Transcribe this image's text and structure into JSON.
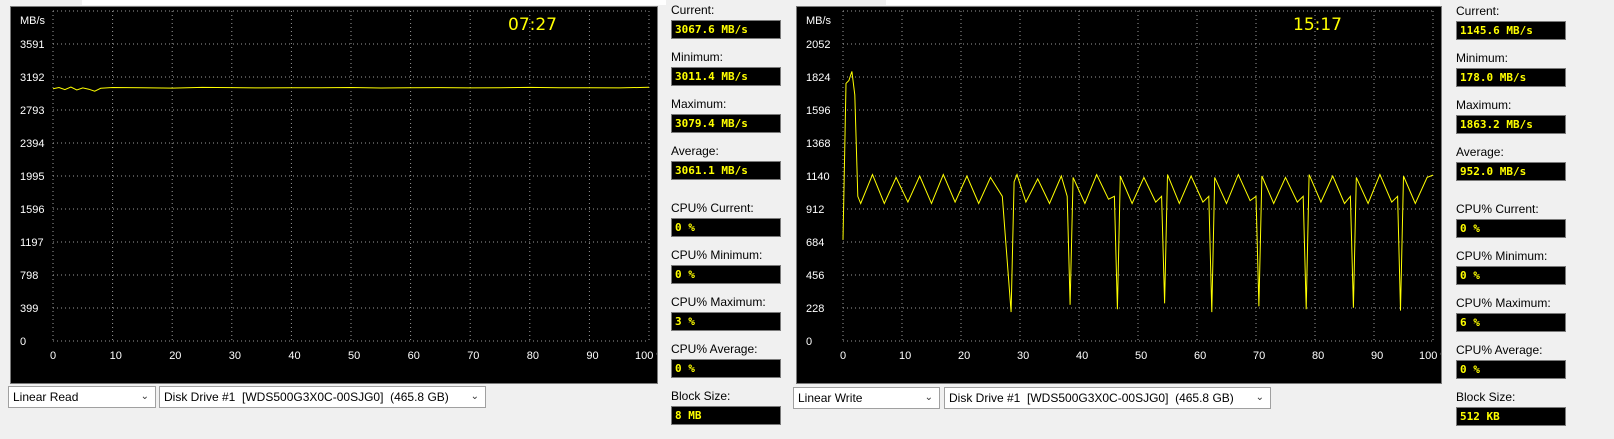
{
  "accent_color": "#ffff00",
  "panels": [
    {
      "time": "07:27",
      "ylabel": "MB/s",
      "mode_select": "Linear Read",
      "drive_select": "Disk Drive #1  [WDS500G3X0C-00SJG0]  (465.8 GB)",
      "stats": [
        {
          "label": "Current:",
          "value": "3067.6 MB/s"
        },
        {
          "label": "Minimum:",
          "value": "3011.4 MB/s"
        },
        {
          "label": "Maximum:",
          "value": "3079.4 MB/s"
        },
        {
          "label": "Average:",
          "value": "3061.1 MB/s"
        },
        {
          "label": "CPU% Current:",
          "value": "0 %"
        },
        {
          "label": "CPU% Minimum:",
          "value": "0 %"
        },
        {
          "label": "CPU% Maximum:",
          "value": "3 %"
        },
        {
          "label": "CPU% Average:",
          "value": "0 %"
        },
        {
          "label": "Block Size:",
          "value": "8 MB"
        }
      ]
    },
    {
      "time": "15:17",
      "ylabel": "MB/s",
      "mode_select": "Linear Write",
      "drive_select": "Disk Drive #1  [WDS500G3X0C-00SJG0]  (465.8 GB)",
      "stats": [
        {
          "label": "Current:",
          "value": "1145.6 MB/s"
        },
        {
          "label": "Minimum:",
          "value": "178.0 MB/s"
        },
        {
          "label": "Maximum:",
          "value": "1863.2 MB/s"
        },
        {
          "label": "Average:",
          "value": "952.0 MB/s"
        },
        {
          "label": "CPU% Current:",
          "value": "0 %"
        },
        {
          "label": "CPU% Minimum:",
          "value": "0 %"
        },
        {
          "label": "CPU% Maximum:",
          "value": "6 %"
        },
        {
          "label": "CPU% Average:",
          "value": "0 %"
        },
        {
          "label": "Block Size:",
          "value": "512 KB"
        }
      ]
    }
  ],
  "chart_data": [
    {
      "type": "line",
      "ylabel": "MB/s",
      "y_ticks": [
        "0",
        "399",
        "798",
        "1197",
        "1596",
        "1995",
        "2394",
        "2793",
        "3192",
        "3591"
      ],
      "x_ticks": [
        "0",
        "10",
        "20",
        "30",
        "40",
        "50",
        "60",
        "70",
        "80",
        "90",
        "100 %"
      ],
      "xlim": [
        0,
        100
      ],
      "ylim": [
        0,
        3990
      ],
      "grid": true,
      "series": [
        {
          "x": [
            0,
            1,
            2,
            3,
            4,
            5,
            6,
            7,
            8,
            9,
            10,
            15,
            20,
            25,
            30,
            35,
            40,
            45,
            50,
            55,
            60,
            65,
            70,
            75,
            80,
            85,
            90,
            95,
            100
          ],
          "y": [
            3050,
            3065,
            3040,
            3070,
            3035,
            3060,
            3045,
            3020,
            3055,
            3060,
            3065,
            3062,
            3058,
            3066,
            3064,
            3060,
            3063,
            3061,
            3065,
            3059,
            3062,
            3064,
            3060,
            3063,
            3066,
            3061,
            3062,
            3060,
            3068
          ]
        }
      ]
    },
    {
      "type": "line",
      "ylabel": "MB/s",
      "y_ticks": [
        "0",
        "228",
        "456",
        "684",
        "912",
        "1140",
        "1368",
        "1596",
        "1824",
        "2052"
      ],
      "x_ticks": [
        "0",
        "10",
        "20",
        "30",
        "40",
        "50",
        "60",
        "70",
        "80",
        "90",
        "100 %"
      ],
      "xlim": [
        0,
        100
      ],
      "ylim": [
        0,
        2280
      ],
      "grid": true,
      "series": [
        {
          "x": [
            0,
            0.5,
            1,
            1.5,
            2,
            2.5,
            3,
            5,
            7,
            9,
            11,
            13,
            15,
            17,
            19,
            21,
            23,
            25,
            27,
            28.5,
            29,
            29.5,
            31,
            33,
            35,
            37,
            38,
            38.5,
            39,
            41,
            43,
            45,
            46,
            46.5,
            47,
            49,
            51,
            53,
            54,
            54.5,
            55,
            57,
            59,
            61,
            62,
            62.5,
            63,
            65,
            67,
            69,
            70,
            70.5,
            71,
            73,
            75,
            77,
            78,
            78.5,
            79,
            81,
            83,
            85,
            86,
            86.5,
            87,
            89,
            91,
            93,
            94,
            94.5,
            95,
            97,
            99,
            100
          ],
          "y": [
            700,
            1780,
            1800,
            1863,
            1700,
            1000,
            950,
            1150,
            950,
            1130,
            960,
            1140,
            950,
            1150,
            960,
            1140,
            950,
            1130,
            1000,
            200,
            1100,
            1150,
            960,
            1120,
            950,
            1140,
            1000,
            250,
            1130,
            950,
            1150,
            980,
            1000,
            220,
            1140,
            950,
            1130,
            960,
            1000,
            260,
            1150,
            950,
            1140,
            960,
            1000,
            200,
            1130,
            950,
            1150,
            970,
            1000,
            240,
            1140,
            950,
            1130,
            960,
            1000,
            220,
            1150,
            960,
            1140,
            950,
            1000,
            230,
            1130,
            950,
            1150,
            960,
            1000,
            210,
            1140,
            950,
            1130,
            1146
          ]
        }
      ]
    }
  ]
}
